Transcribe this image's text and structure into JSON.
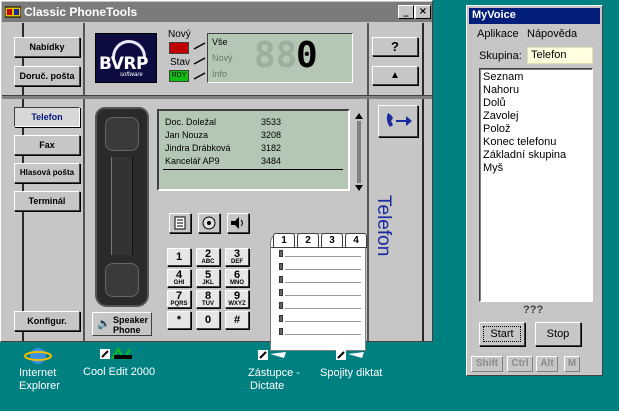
{
  "phonetools": {
    "title": "Classic PhoneTools",
    "controls": {
      "minimize": "_",
      "maximize": "□",
      "close": "×"
    },
    "top_buttons": [
      "Nabídky",
      "Doruč. pošta"
    ],
    "logo": {
      "text": "BVRP",
      "sub": "software"
    },
    "status": {
      "new_label": "Nový",
      "state_label": "Stav",
      "led_rdy": "RDY",
      "lines": [
        "Vše",
        "Nový",
        "Info"
      ],
      "counter_dim": "88",
      "counter_value": "0"
    },
    "right_buttons": {
      "help": "?",
      "up": "▲"
    },
    "mode_buttons": [
      "Telefon",
      "Fax",
      "Hlasová pošta",
      "Terminál"
    ],
    "config_button": "Konfigur.",
    "speaker_button": {
      "line1": "Speaker",
      "line2": "Phone"
    },
    "directory": [
      {
        "name": "Doc. Doležal",
        "number": "3533"
      },
      {
        "name": "Jan Nouza",
        "number": "3208"
      },
      {
        "name": "Jindra Drábková",
        "number": "3182"
      },
      {
        "name": "Kancelář AP9",
        "number": "3484"
      }
    ],
    "keypad": [
      {
        "d": "1",
        "s": ""
      },
      {
        "d": "2",
        "s": "ABC"
      },
      {
        "d": "3",
        "s": "DEF"
      },
      {
        "d": "4",
        "s": "GHI"
      },
      {
        "d": "5",
        "s": "JKL"
      },
      {
        "d": "6",
        "s": "MNO"
      },
      {
        "d": "7",
        "s": "PQRS"
      },
      {
        "d": "8",
        "s": "TUV"
      },
      {
        "d": "9",
        "s": "WXYZ"
      },
      {
        "d": "*",
        "s": ""
      },
      {
        "d": "0",
        "s": ""
      },
      {
        "d": "#",
        "s": ""
      }
    ],
    "memo_tabs": [
      "1",
      "2",
      "3",
      "4"
    ],
    "side_label": "Telefon",
    "colors": {
      "led_red": "#c00000",
      "led_green": "#10c010",
      "lcd": "#b4c6b4",
      "accent_blue": "#1a2aa0"
    }
  },
  "myvoice": {
    "title": "MyVoice",
    "menu": [
      "Aplikace",
      "Nápověda"
    ],
    "group_label": "Skupina:",
    "group_value": "Telefon",
    "list": [
      "Seznam",
      "Nahoru",
      "Dolů",
      "Zavolej",
      "Polož",
      "Konec telefonu",
      "Základní skupina",
      "Myš"
    ],
    "status": "???",
    "start": "Start",
    "stop": "Stop",
    "modifiers": [
      "Shift",
      "Ctrl",
      "Alt",
      "M"
    ]
  },
  "desktop": {
    "icons": [
      {
        "line1": "Internet",
        "line2": "Explorer"
      },
      {
        "line1": "Cool Edit 2000",
        "line2": ""
      },
      {
        "line1": "Zástupce -",
        "line2": "Dictate"
      },
      {
        "line1": "Spojity diktat",
        "line2": ""
      }
    ]
  }
}
